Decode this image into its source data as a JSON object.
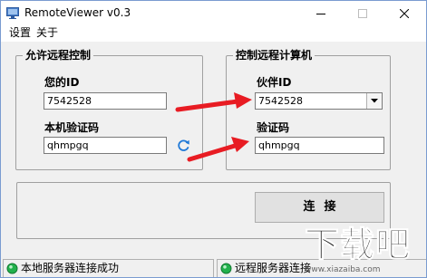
{
  "window": {
    "title": "RemoteViewer v0.3",
    "icon": "monitor-icon",
    "controls": [
      "minimize-icon",
      "maximize-icon",
      "close-icon"
    ]
  },
  "menu": {
    "settings": "设置",
    "about": "关于"
  },
  "allow_remote": {
    "title": "允许远程控制",
    "id_label": "您的ID",
    "id_value": "7542528",
    "code_label": "本机验证码",
    "code_value": "qhmpgq",
    "refresh_icon": "refresh-icon"
  },
  "control_remote": {
    "title": "控制远程计算机",
    "partner_id_label": "伙伴ID",
    "partner_id_value": "7542528",
    "code_label": "验证码",
    "code_value": "qhmpgq"
  },
  "connect_button": "连接",
  "status": {
    "local": "本地服务器连接成功",
    "remote": "远程服务器连接",
    "ok_color": "#22b14c"
  },
  "annotation_color": "#e81c23",
  "watermark": {
    "text": "下载吧",
    "url": "www.xiazaiba.com"
  }
}
